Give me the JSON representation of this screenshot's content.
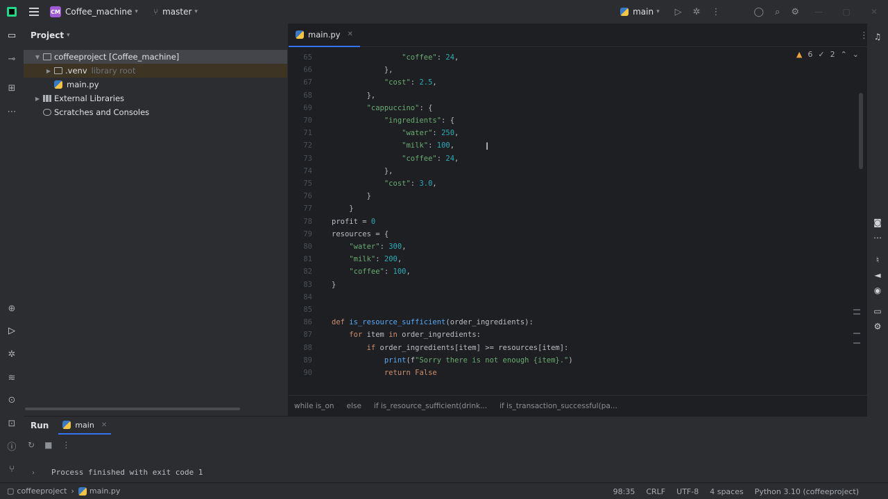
{
  "titlebar": {
    "project_badge": "CM",
    "project_name": "Coffee_machine",
    "branch": "master",
    "run_config": "main"
  },
  "project_panel": {
    "title": "Project",
    "tree": [
      {
        "label": "coffeeproject [Coffee_machine]",
        "type": "folder",
        "expanded": true
      },
      {
        "label": ".venv",
        "type": "folder",
        "expanded": false,
        "note": "library root"
      },
      {
        "label": "main.py",
        "type": "python-file"
      },
      {
        "label": "External Libraries",
        "type": "library",
        "expanded": false
      },
      {
        "label": "Scratches and Consoles",
        "type": "scratch"
      }
    ]
  },
  "editor": {
    "tab": "main.py",
    "inspection": {
      "warnings": "6",
      "weak_warnings": "2"
    },
    "lines": [
      "                \"coffee\": 24,",
      "            },",
      "            \"cost\": 2.5,",
      "        },",
      "        \"cappuccino\": {",
      "            \"ingredients\": {",
      "                \"water\": 250,",
      "                \"milk\": 100,",
      "                \"coffee\": 24,",
      "            },",
      "            \"cost\": 3.0,",
      "        }",
      "    }",
      "profit = 0",
      "resources = {",
      "    \"water\": 300,",
      "    \"milk\": 200,",
      "    \"coffee\": 100,",
      "}",
      "",
      "",
      "def is_resource_sufficient(order_ingredients):",
      "    for item in order_ingredients:",
      "        if order_ingredients[item] >= resources[item]:",
      "            print(f\"Sorry there is not enough {item}.\")",
      "            return False"
    ],
    "breadcrumb": [
      "while is_on",
      "else",
      "if is_resource_sufficient(drink...",
      "if is_transaction_successful(pa..."
    ]
  },
  "run_panel": {
    "title": "Run",
    "tab": "main",
    "output": "Process finished with exit code 1"
  },
  "statusbar": {
    "path_root": "coffeeproject",
    "path_file": "main.py",
    "position": "98:35",
    "line_sep": "CRLF",
    "encoding": "UTF-8",
    "indent": "4 spaces",
    "interpreter": "Python 3.10 (coffeeproject)"
  },
  "colors": {
    "background": "#1e1f22",
    "panel": "#2b2d30",
    "accent": "#3574f0",
    "keyword": "#cf8e6d",
    "string": "#6aab73",
    "number": "#2aacb8",
    "function": "#56a8f5"
  }
}
